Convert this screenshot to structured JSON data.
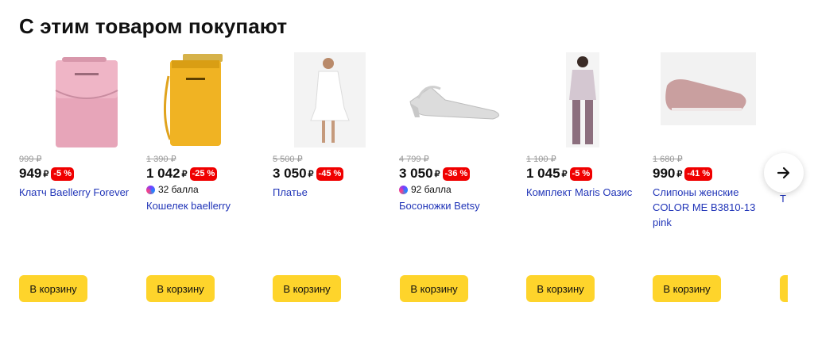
{
  "section": {
    "title": "С этим товаром покупают"
  },
  "products": [
    {
      "old_price": "999 ₽",
      "price": "949",
      "currency": "₽",
      "discount": "-5 %",
      "bonus": "",
      "name": "Клатч Baellerry Forever"
    },
    {
      "old_price": "1 390 ₽",
      "price": "1 042",
      "currency": "₽",
      "discount": "-25 %",
      "bonus": "32 балла",
      "name": "Кошелек baellerry"
    },
    {
      "old_price": "5 500 ₽",
      "price": "3 050",
      "currency": "₽",
      "discount": "-45 %",
      "bonus": "",
      "name": "Платье"
    },
    {
      "old_price": "4 799 ₽",
      "price": "3 050",
      "currency": "₽",
      "discount": "-36 %",
      "bonus": "92 балла",
      "name": "Босоножки Betsy"
    },
    {
      "old_price": "1 100 ₽",
      "price": "1 045",
      "currency": "₽",
      "discount": "-5 %",
      "bonus": "",
      "name": "Комплект Maris Оазис"
    },
    {
      "old_price": "1 680 ₽",
      "price": "990",
      "currency": "₽",
      "discount": "-41 %",
      "bonus": "",
      "name": "Слипоны женские COLOR ME B3810-13 pink"
    }
  ],
  "cart_button_label": "В корзину",
  "partial_name": "Т",
  "icons": {
    "next": "arrow-right-icon",
    "bonus": "plus-points-icon"
  },
  "colors": {
    "accent": "#fed42b",
    "discount": "#f00000",
    "link": "#2135b8"
  }
}
